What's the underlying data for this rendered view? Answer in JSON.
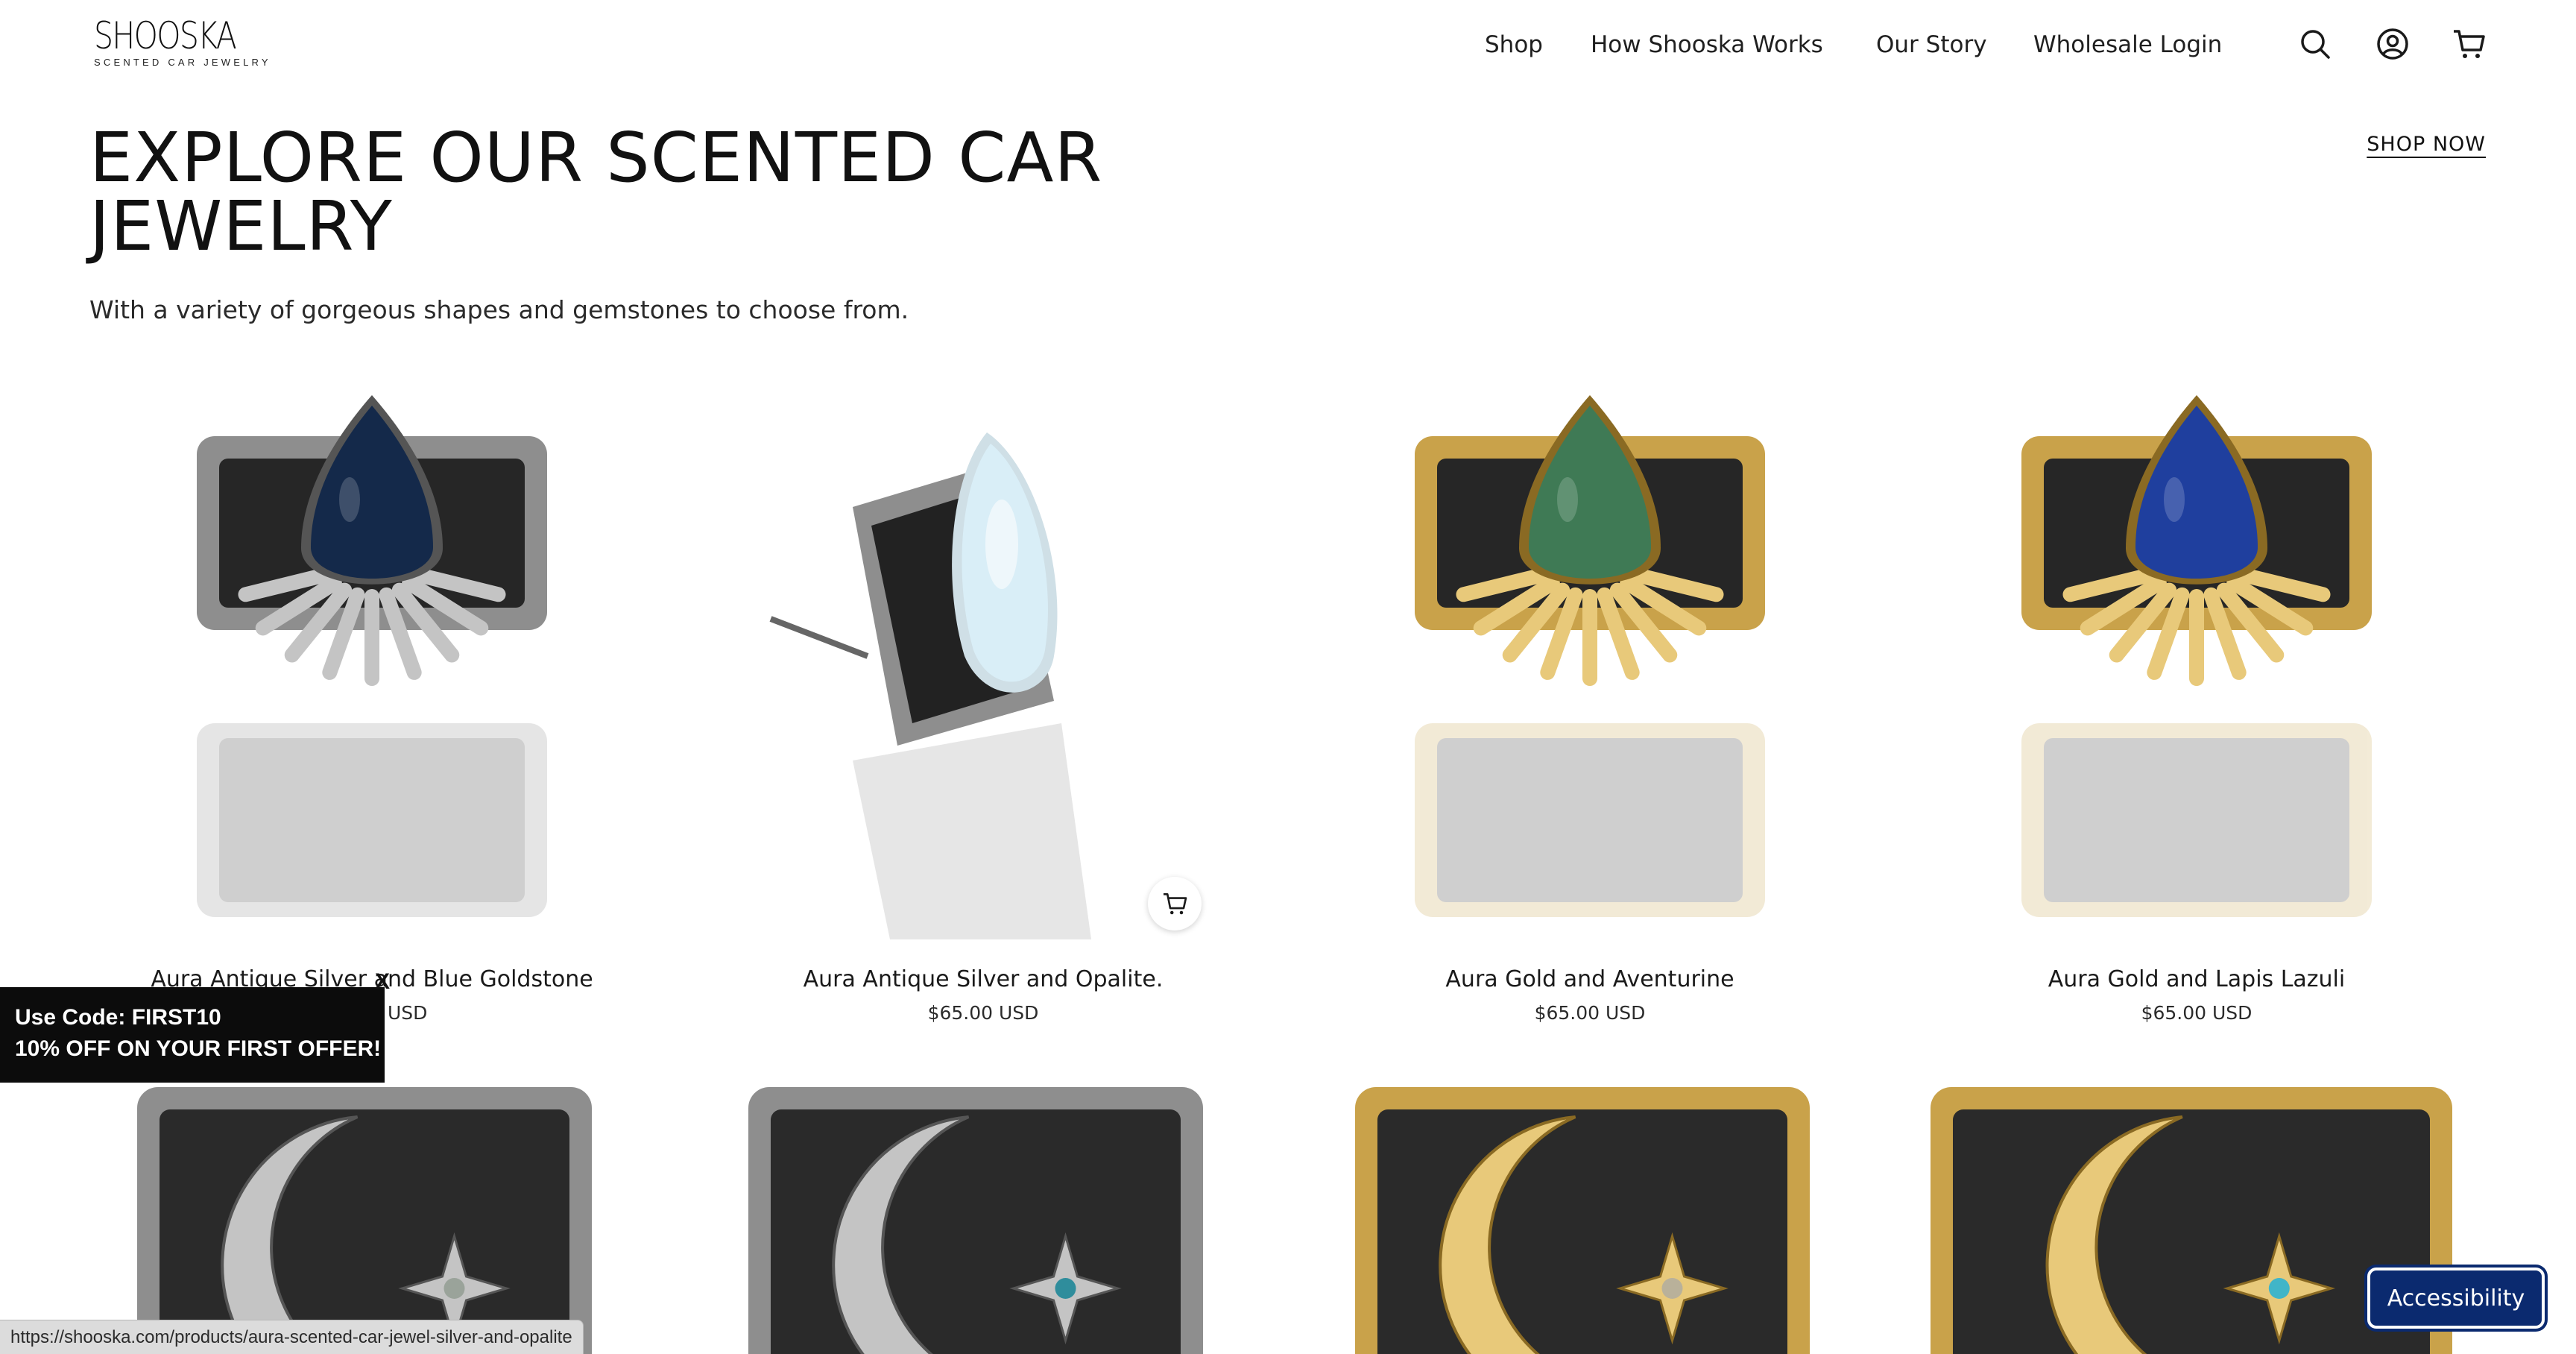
{
  "brand": {
    "name": "SHOOSKA",
    "tagline": "SCENTED CAR JEWELRY"
  },
  "nav": {
    "shop": "Shop",
    "how_it_works": "How Shooska Works",
    "our_story": "Our Story",
    "wholesale": "Wholesale Login"
  },
  "hero": {
    "headline_line1": "EXPLORE OUR SCENTED CAR",
    "headline_line2": "JEWELRY",
    "subheadline": "With a variety of gorgeous shapes and gemstones to choose from.",
    "cta": "SHOP NOW"
  },
  "products": [
    {
      "title": "Aura Antique Silver and Blue Goldstone",
      "price": "$65.00 USD",
      "metal": "silver",
      "stone_color": "#14294a",
      "style": "teardrop-front"
    },
    {
      "title": "Aura Antique Silver and Opalite.",
      "price": "$65.00 USD",
      "metal": "silver",
      "stone_color": "#d9eef7",
      "style": "teardrop-side"
    },
    {
      "title": "Aura Gold and Aventurine",
      "price": "$65.00 USD",
      "metal": "gold",
      "stone_color": "#3f7a55",
      "style": "teardrop-front"
    },
    {
      "title": "Aura Gold and Lapis Lazuli",
      "price": "$65.00 USD",
      "metal": "gold",
      "stone_color": "#1f3f9e",
      "style": "teardrop-front"
    }
  ],
  "products_row2": [
    {
      "metal": "silver",
      "stone_color": "#9aa39a",
      "style": "moon"
    },
    {
      "metal": "silver",
      "stone_color": "#2f8d9c",
      "style": "moon"
    },
    {
      "metal": "gold",
      "stone_color": "#b9b19a",
      "style": "moon"
    },
    {
      "metal": "gold",
      "stone_color": "#41b5c8",
      "style": "moon"
    }
  ],
  "promo": {
    "line1": "Use Code: FIRST10",
    "line2": "10% OFF ON YOUR FIRST OFFER!",
    "close": "X"
  },
  "status_url": "https://shooska.com/products/aura-scented-car-jewel-silver-and-opalite",
  "accessibility": "Accessibility",
  "icons": {
    "search": "search-icon",
    "account": "account-icon",
    "cart": "cart-icon",
    "quick_add": "cart-icon"
  },
  "colors": {
    "text": "#1a1a1a",
    "promo_bg": "#0c0c0c",
    "accessibility_bg": "#0b2a6f",
    "gold": "#c9a24a",
    "silver": "#8e8e8e"
  }
}
